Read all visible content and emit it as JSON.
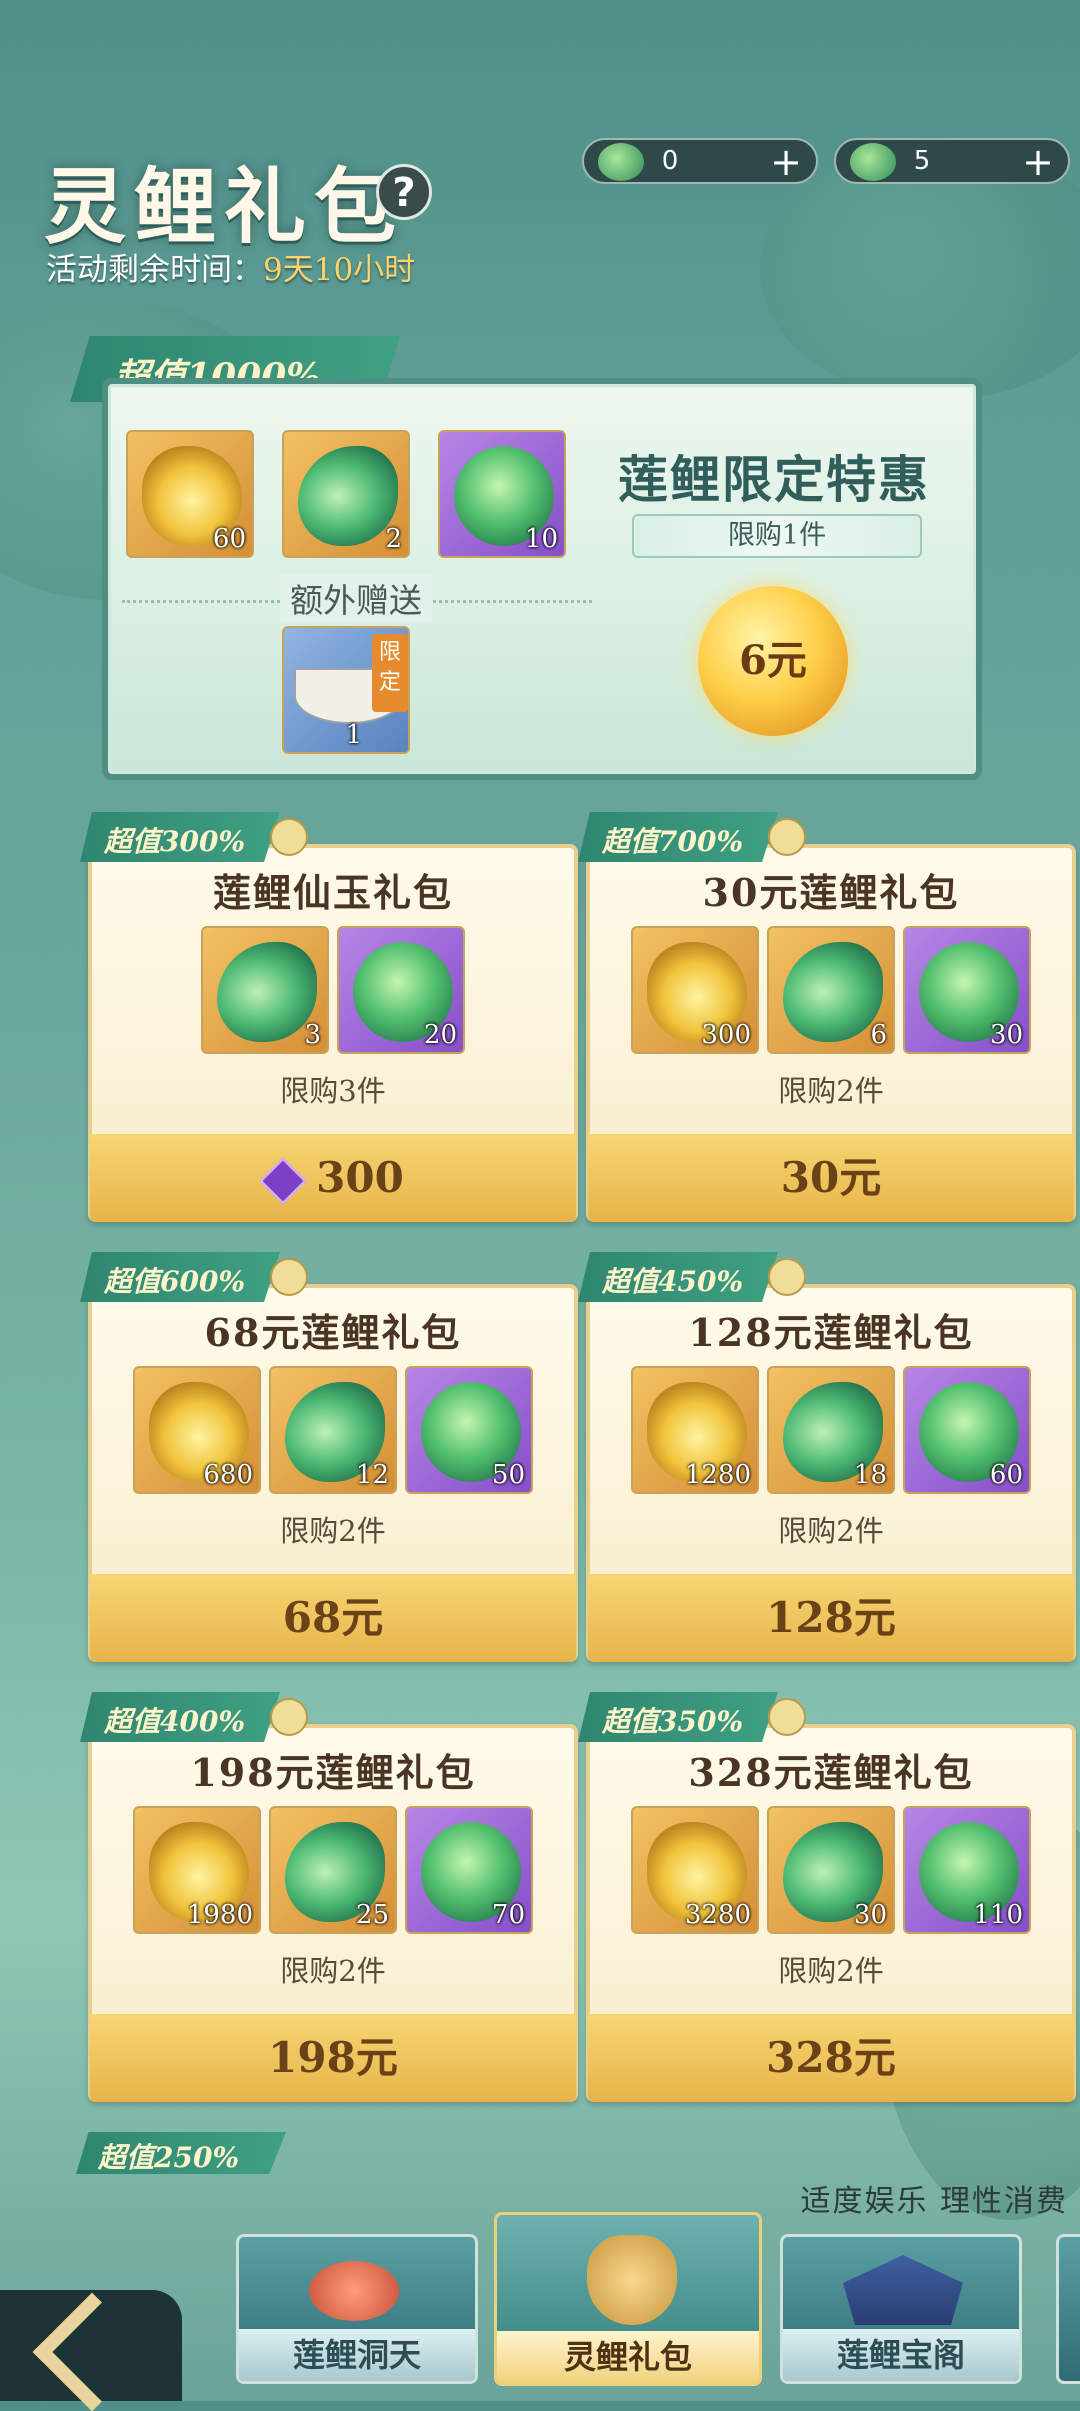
{
  "header": {
    "title": "灵鲤礼包",
    "help_icon": "?",
    "timer_label": "活动剩余时间：",
    "timer_value": "9天10小时"
  },
  "currencies": [
    {
      "icon": "koi-token-icon",
      "value": "0",
      "plus": "+"
    },
    {
      "icon": "lotus-leaf-icon",
      "value": "5",
      "plus": "+"
    }
  ],
  "featured": {
    "badge": "超值1000%",
    "name": "莲鲤限定特惠",
    "limit": "限购1件",
    "price": "6元",
    "extra_label": "额外赠送",
    "items": [
      {
        "icon": "golden-lotus-icon",
        "count": "60"
      },
      {
        "icon": "green-koi-icon",
        "count": "2"
      },
      {
        "icon": "lotus-leaf-icon",
        "count": "10"
      }
    ],
    "bonus_item": {
      "icon": "lotus-boat-icon",
      "tag": "限定",
      "count": "1"
    }
  },
  "packs": [
    {
      "badge": "超值300%",
      "name": "莲鲤仙玉礼包",
      "limit": "限购3件",
      "price": "300",
      "price_icon": "jade-gem-icon",
      "items": [
        {
          "icon": "green-koi-icon",
          "count": "3"
        },
        {
          "icon": "lotus-leaf-icon",
          "count": "20"
        }
      ]
    },
    {
      "badge": "超值700%",
      "name": "30元莲鲤礼包",
      "limit": "限购2件",
      "price": "30元",
      "items": [
        {
          "icon": "golden-lotus-icon",
          "count": "300"
        },
        {
          "icon": "green-koi-icon",
          "count": "6"
        },
        {
          "icon": "lotus-leaf-icon",
          "count": "30"
        }
      ]
    },
    {
      "badge": "超值600%",
      "name": "68元莲鲤礼包",
      "limit": "限购2件",
      "price": "68元",
      "items": [
        {
          "icon": "golden-lotus-icon",
          "count": "680"
        },
        {
          "icon": "green-koi-icon",
          "count": "12"
        },
        {
          "icon": "lotus-leaf-icon",
          "count": "50"
        }
      ]
    },
    {
      "badge": "超值450%",
      "name": "128元莲鲤礼包",
      "limit": "限购2件",
      "price": "128元",
      "items": [
        {
          "icon": "golden-lotus-icon",
          "count": "1280"
        },
        {
          "icon": "green-koi-icon",
          "count": "18"
        },
        {
          "icon": "lotus-leaf-icon",
          "count": "60"
        }
      ]
    },
    {
      "badge": "超值400%",
      "name": "198元莲鲤礼包",
      "limit": "限购2件",
      "price": "198元",
      "items": [
        {
          "icon": "golden-lotus-icon",
          "count": "1980"
        },
        {
          "icon": "green-koi-icon",
          "count": "25"
        },
        {
          "icon": "lotus-leaf-icon",
          "count": "70"
        }
      ]
    },
    {
      "badge": "超值350%",
      "name": "328元莲鲤礼包",
      "limit": "限购2件",
      "price": "328元",
      "items": [
        {
          "icon": "golden-lotus-icon",
          "count": "3280"
        },
        {
          "icon": "green-koi-icon",
          "count": "30"
        },
        {
          "icon": "lotus-leaf-icon",
          "count": "110"
        }
      ]
    }
  ],
  "partial_pack": {
    "badge": "超值250%"
  },
  "notice": "适度娱乐 理性消费",
  "nav": [
    {
      "label": "莲鲤洞天",
      "active": false
    },
    {
      "label": "灵鲤礼包",
      "active": true
    },
    {
      "label": "莲鲤宝阁",
      "active": false
    }
  ]
}
